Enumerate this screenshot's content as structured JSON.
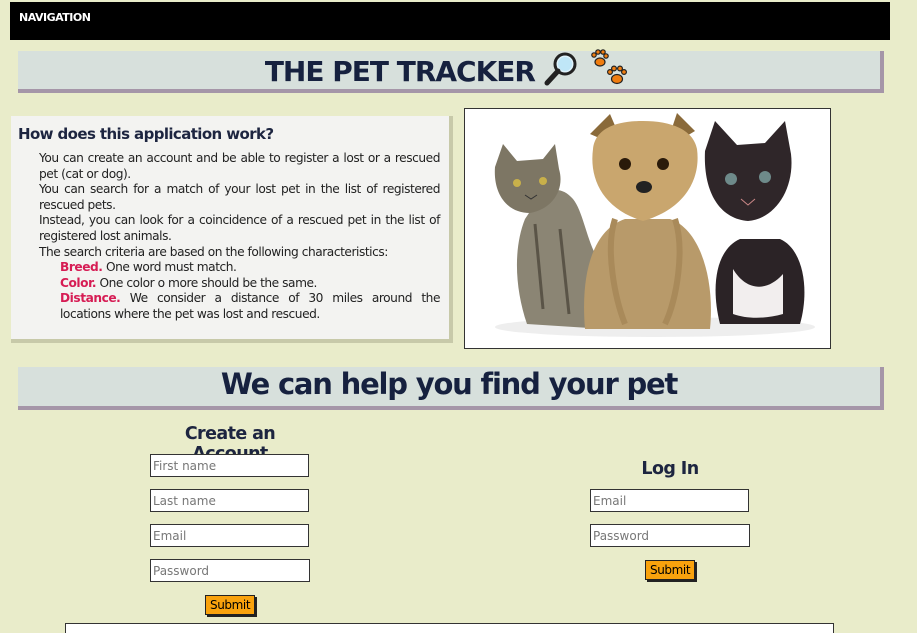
{
  "nav": {
    "label": "NAVIGATION"
  },
  "header": {
    "title": "THE PET TRACKER"
  },
  "info": {
    "heading": "How does this application work?",
    "paragraphs": [
      "You can create an account and be able to register a lost or a rescued pet (cat or dog).",
      "You can search for a match of your lost pet in the list of registered rescued pets.",
      "Instead, you can look for a coincidence of a rescued pet in the list of registered lost animals.",
      "The search criteria are based on the following characteristics:"
    ],
    "criteria": [
      {
        "label": "Breed.",
        "text": "One word must match."
      },
      {
        "label": "Color.",
        "text": "One color o more should be the same."
      },
      {
        "label": "Distance.",
        "text": "We consider a distance of 30 miles around the locations where the pet was lost and rescued."
      }
    ]
  },
  "help": {
    "title": "We can help you find your pet"
  },
  "create_account": {
    "title": "Create an Account",
    "first_name_placeholder": "First name",
    "last_name_placeholder": "Last name",
    "email_placeholder": "Email",
    "password_placeholder": "Password",
    "submit_label": "Submit"
  },
  "login": {
    "title": "Log In",
    "email_placeholder": "Email",
    "password_placeholder": "Password",
    "submit_label": "Submit"
  },
  "colors": {
    "page_bg": "#e9ecca",
    "banner_bg": "#d7e0dc",
    "banner_shadow": "#a596a8",
    "criteria_accent": "#d61c54",
    "button_bg": "#f9a20d"
  },
  "icons": [
    "magnifier-icon",
    "paw-prints-icon"
  ]
}
